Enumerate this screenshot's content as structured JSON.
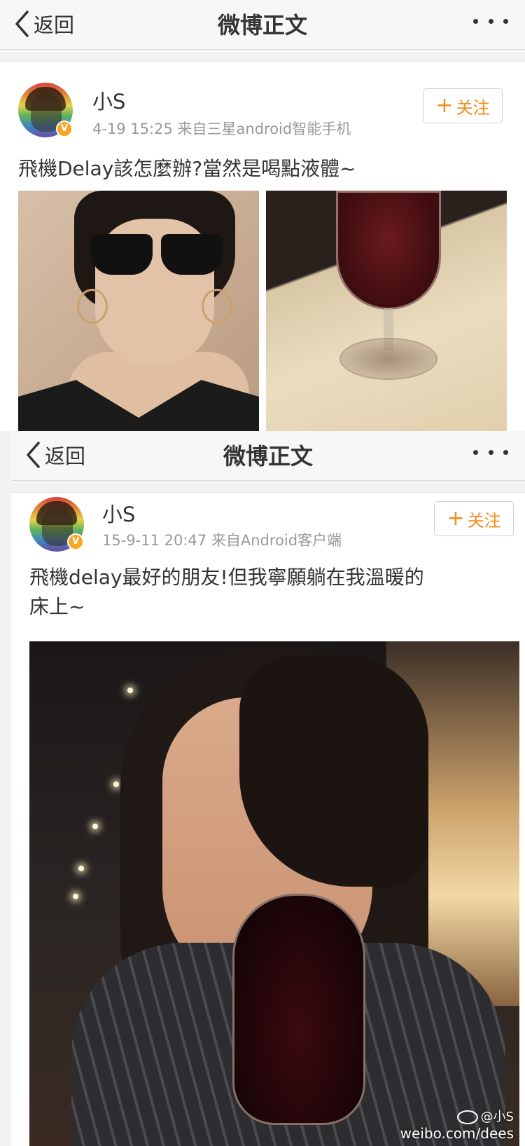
{
  "screens": [
    {
      "nav": {
        "back_label": "返回",
        "title": "微博正文"
      },
      "post": {
        "username": "小S",
        "verified_badge": "V",
        "meta": "4-19 15:25  来自三星android智能手机",
        "follow_label": "关注",
        "text": "飛機Delay該怎麼辦?當然是喝點液體~",
        "images": [
          "selfie-with-sunglasses",
          "red-wine-glass"
        ]
      }
    },
    {
      "nav": {
        "back_label": "返回",
        "title": "微博正文"
      },
      "post": {
        "username": "小S",
        "verified_badge": "V",
        "meta": "15-9-11 20:47  来自Android客户端",
        "follow_label": "关注",
        "text_line1": "飛機delay最好的朋友!但我寧願躺在我溫暖的",
        "text_line2": "床上~",
        "images": [
          "selfie-drinking-wine"
        ]
      }
    }
  ],
  "watermark": {
    "name": "@小S",
    "url": "weibo.com/dees"
  },
  "colors": {
    "follow_accent": "#f28c1a",
    "verified_badge": "#f5a623",
    "meta_text": "#999999"
  }
}
